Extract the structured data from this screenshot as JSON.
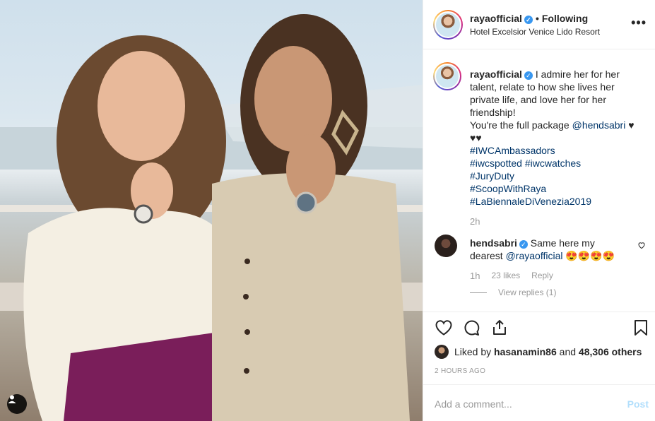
{
  "post": {
    "username": "rayaofficial",
    "follow_status": "Following",
    "separator": "•",
    "location": "Hotel Excelsior Venice Lido Resort",
    "more_label": "•••"
  },
  "caption": {
    "username": "rayaofficial",
    "text_line1": "I admire her for her talent, relate to how she lives her private life, and love her for her friendship!",
    "text_line2_prefix": "You're the full package",
    "mention": "@hendsabri",
    "hearts": "♥ ♥♥",
    "hashtags": [
      "#IWCAmbassadors",
      "#iwcspotted #iwcwatches",
      "#JuryDuty",
      "#ScoopWithRaya",
      "#LaBiennaleDiVenezia2019"
    ],
    "time": "2h"
  },
  "reply": {
    "username": "hendsabri",
    "text": "Same here my dearest",
    "mention": "@rayaofficial",
    "emoji": "😍😍😍😍",
    "time": "1h",
    "likes": "23 likes",
    "reply_label": "Reply",
    "view_replies": "View replies (1)"
  },
  "likes": {
    "prefix": "Liked by",
    "user": "hasanamin86",
    "middle": "and",
    "count": "48,306 others"
  },
  "posted_time": "2 HOURS AGO",
  "comment_input": {
    "placeholder": "Add a comment...",
    "post_label": "Post"
  },
  "colors": {
    "link": "#003569",
    "verified": "#3897f0",
    "post_disabled": "#b2dffc",
    "muted": "#999999"
  },
  "icons": [
    "verified-badge-icon",
    "more-options-icon",
    "heart-icon",
    "comment-icon",
    "share-icon",
    "bookmark-icon",
    "user-tag-icon"
  ]
}
